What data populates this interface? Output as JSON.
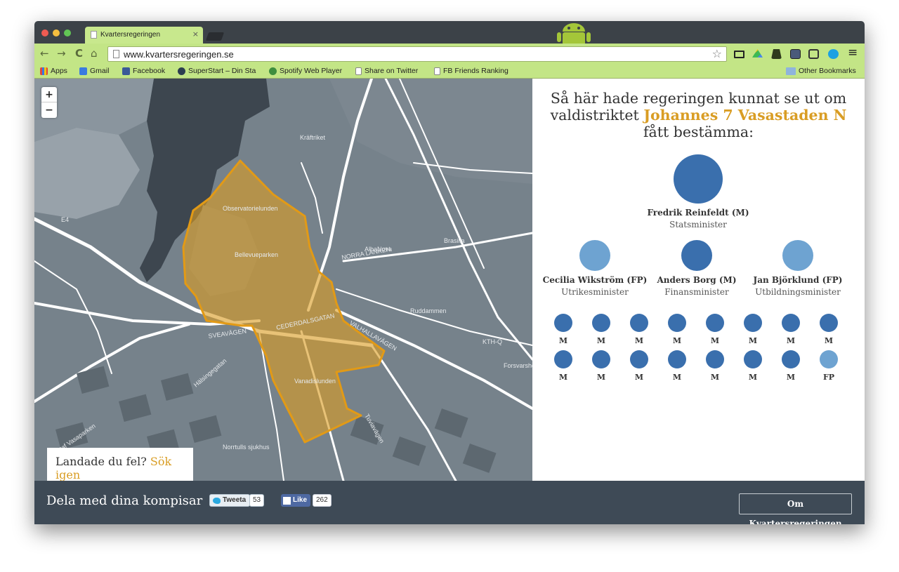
{
  "browser": {
    "tab_title": "Kvartersregeringen",
    "tab_close": "×",
    "url": "www.kvartersregeringen.se",
    "nav": {
      "back": "←",
      "forward": "→",
      "reload": "C",
      "home": "⌂",
      "star": "☆",
      "menu": "≡"
    },
    "bookmarks": [
      {
        "label": "Apps",
        "icon": "apps-grid-icon",
        "color": "#e0463c"
      },
      {
        "label": "Gmail",
        "icon": "google-icon",
        "color": "#3a7be0"
      },
      {
        "label": "Facebook",
        "icon": "facebook-icon",
        "color": "#3b5998"
      },
      {
        "label": "SuperStart – Din Sta",
        "icon": "superstart-icon",
        "color": "#2c3e50"
      },
      {
        "label": "Spotify Web Player",
        "icon": "spotify-icon",
        "color": "#3e8e3e"
      },
      {
        "label": "Share on Twitter",
        "icon": "page-icon",
        "color": "#ffffff"
      },
      {
        "label": "FB Friends Ranking",
        "icon": "page-icon",
        "color": "#ffffff"
      }
    ],
    "other_bookmarks": "Other Bookmarks"
  },
  "map": {
    "zoom_in": "+",
    "zoom_out": "−",
    "labels": [
      "Kräftriket",
      "Bellevueparken",
      "Observatorielunden",
      "Vanadislunden",
      "Ruddammen",
      "Brasilia",
      "AlbaNova",
      "Norrtulls sjukhus",
      "KTH-Q",
      "Forsvarshögskolan",
      "CEDERDALSGATAN",
      "SVEAVÄGEN",
      "VALHALLAVÄGEN",
      "NORRA LÄNKEN",
      "E4",
      "Gustaf Vasaparken",
      "Hälsingegatan",
      "Tuviavägen"
    ],
    "relocate_text": "Landade du fel?",
    "relocate_link": "Sök igen"
  },
  "panel": {
    "headline_pre": "Så här hade regeringen kunnat se ut om valdistriktet",
    "district": "Johannes 7 Vasastaden N",
    "headline_post": "fått bestämma:",
    "pm": {
      "name": "Fredrik Reinfeldt (M)",
      "role": "Statsminister",
      "color": "#3a6fad"
    },
    "ministers": [
      {
        "name": "Cecilia Wikström (FP)",
        "role": "Utrikesminister",
        "color": "#6ea3d1"
      },
      {
        "name": "Anders Borg (M)",
        "role": "Finansminister",
        "color": "#3a6fad"
      },
      {
        "name": "Jan Björklund (FP)",
        "role": "Utbildningsminister",
        "color": "#6ea3d1"
      }
    ],
    "seats": [
      {
        "party": "M",
        "color": "#3a6fad"
      },
      {
        "party": "M",
        "color": "#3a6fad"
      },
      {
        "party": "M",
        "color": "#3a6fad"
      },
      {
        "party": "M",
        "color": "#3a6fad"
      },
      {
        "party": "M",
        "color": "#3a6fad"
      },
      {
        "party": "M",
        "color": "#3a6fad"
      },
      {
        "party": "M",
        "color": "#3a6fad"
      },
      {
        "party": "M",
        "color": "#3a6fad"
      },
      {
        "party": "M",
        "color": "#3a6fad"
      },
      {
        "party": "M",
        "color": "#3a6fad"
      },
      {
        "party": "M",
        "color": "#3a6fad"
      },
      {
        "party": "M",
        "color": "#3a6fad"
      },
      {
        "party": "M",
        "color": "#3a6fad"
      },
      {
        "party": "M",
        "color": "#3a6fad"
      },
      {
        "party": "M",
        "color": "#3a6fad"
      },
      {
        "party": "FP",
        "color": "#6ea3d1"
      }
    ]
  },
  "footer": {
    "share_title": "Dela med dina kompisar",
    "tweet_label": "Tweeta",
    "tweet_count": "53",
    "like_label": "Like",
    "like_count": "262",
    "about_button": "Om Kvartersregeringen"
  },
  "colors": {
    "accent": "#d99d24",
    "moderat": "#3a6fad",
    "folkpartiet": "#6ea3d1",
    "footer": "#3e4a56",
    "chrome_green": "#c3e586"
  }
}
